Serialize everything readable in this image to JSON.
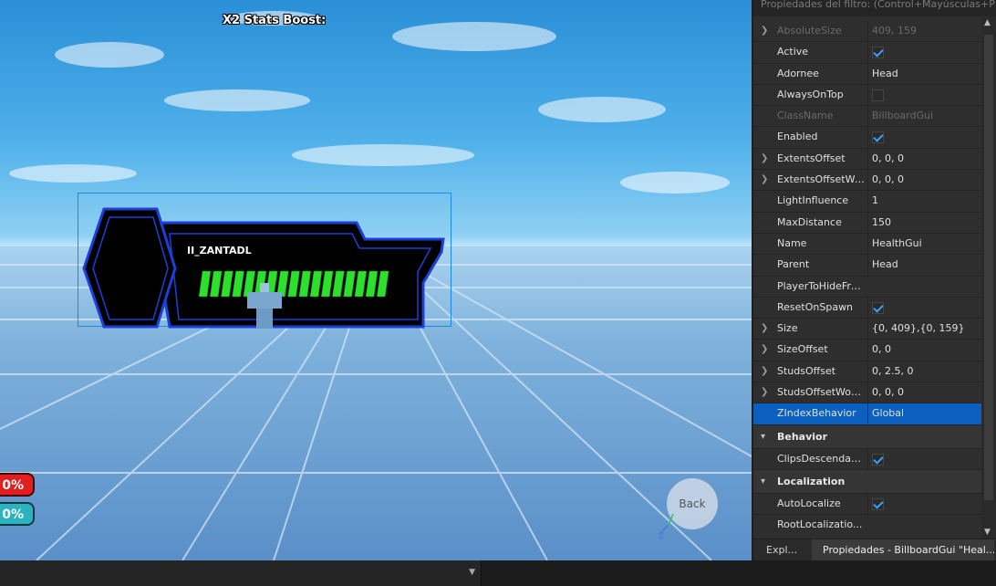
{
  "viewport": {
    "stats_boost": "X2 Stats Boost:",
    "player_name": "II_ZANTADL",
    "health_pct": "0%",
    "other_pct": "0%",
    "back_label": "Back",
    "axis_z": "Z"
  },
  "properties": {
    "filter_placeholder": "Propiedades del filtro: (Control+Mayúsculas+P)",
    "rows": [
      {
        "name": "AbsoluteSize",
        "value": "409, 159",
        "expandable": true,
        "disabled": true
      },
      {
        "name": "Active",
        "check": true
      },
      {
        "name": "Adornee",
        "value": "Head"
      },
      {
        "name": "AlwaysOnTop",
        "check": false
      },
      {
        "name": "ClassName",
        "value": "BillboardGui",
        "disabled": true
      },
      {
        "name": "Enabled",
        "check": true
      },
      {
        "name": "ExtentsOffset",
        "value": "0, 0, 0",
        "expandable": true
      },
      {
        "name": "ExtentsOffsetWo...",
        "value": "0, 0, 0",
        "expandable": true
      },
      {
        "name": "LightInfluence",
        "value": "1"
      },
      {
        "name": "MaxDistance",
        "value": "150"
      },
      {
        "name": "Name",
        "value": "HealthGui"
      },
      {
        "name": "Parent",
        "value": "Head"
      },
      {
        "name": "PlayerToHideFrom",
        "value": ""
      },
      {
        "name": "ResetOnSpawn",
        "check": true
      },
      {
        "name": "Size",
        "value": "{0, 409},{0, 159}",
        "expandable": true
      },
      {
        "name": "SizeOffset",
        "value": "0, 0",
        "expandable": true
      },
      {
        "name": "StudsOffset",
        "value": "0, 2.5, 0",
        "expandable": true
      },
      {
        "name": "StudsOffsetWorl...",
        "value": "0, 0, 0",
        "expandable": true
      },
      {
        "name": "ZIndexBehavior",
        "value": "Global",
        "selected": true
      }
    ],
    "section_behavior": "Behavior",
    "behavior_rows": [
      {
        "name": "ClipsDescendants",
        "check": true
      }
    ],
    "section_localization": "Localization",
    "localization_rows": [
      {
        "name": "AutoLocalize",
        "check": true
      },
      {
        "name": "RootLocalizatio...",
        "value": ""
      }
    ]
  },
  "tabs": {
    "explorer": "Expl...",
    "properties": "Propiedades - BillboardGui \"Heal..."
  },
  "colors": {
    "accent": "#0b5fbf",
    "health_green": "#2ee02e",
    "billboard_blue": "#1c3fd8"
  }
}
